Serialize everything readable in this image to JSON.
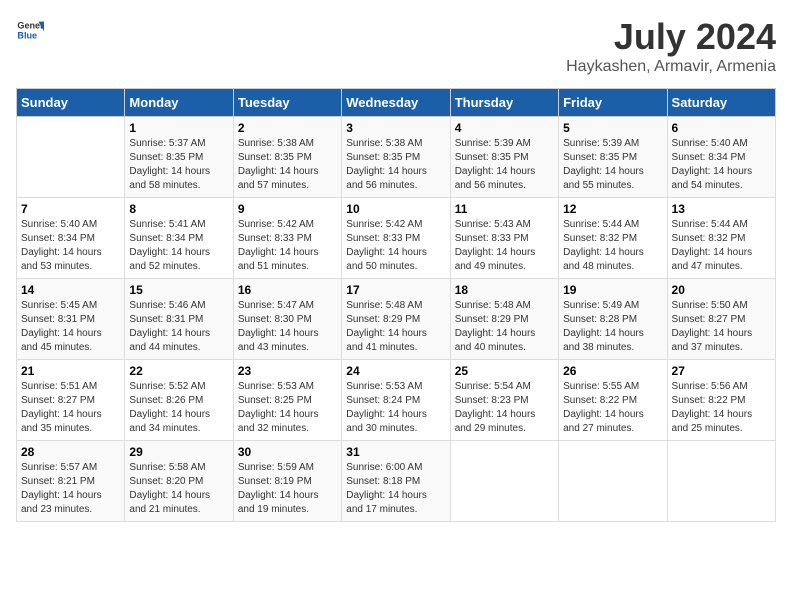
{
  "header": {
    "logo_general": "General",
    "logo_blue": "Blue",
    "month_title": "July 2024",
    "location": "Haykashen, Armavir, Armenia"
  },
  "calendar": {
    "weekdays": [
      "Sunday",
      "Monday",
      "Tuesday",
      "Wednesday",
      "Thursday",
      "Friday",
      "Saturday"
    ],
    "weeks": [
      [
        {
          "day": "",
          "info": ""
        },
        {
          "day": "1",
          "info": "Sunrise: 5:37 AM\nSunset: 8:35 PM\nDaylight: 14 hours\nand 58 minutes."
        },
        {
          "day": "2",
          "info": "Sunrise: 5:38 AM\nSunset: 8:35 PM\nDaylight: 14 hours\nand 57 minutes."
        },
        {
          "day": "3",
          "info": "Sunrise: 5:38 AM\nSunset: 8:35 PM\nDaylight: 14 hours\nand 56 minutes."
        },
        {
          "day": "4",
          "info": "Sunrise: 5:39 AM\nSunset: 8:35 PM\nDaylight: 14 hours\nand 56 minutes."
        },
        {
          "day": "5",
          "info": "Sunrise: 5:39 AM\nSunset: 8:35 PM\nDaylight: 14 hours\nand 55 minutes."
        },
        {
          "day": "6",
          "info": "Sunrise: 5:40 AM\nSunset: 8:34 PM\nDaylight: 14 hours\nand 54 minutes."
        }
      ],
      [
        {
          "day": "7",
          "info": "Sunrise: 5:40 AM\nSunset: 8:34 PM\nDaylight: 14 hours\nand 53 minutes."
        },
        {
          "day": "8",
          "info": "Sunrise: 5:41 AM\nSunset: 8:34 PM\nDaylight: 14 hours\nand 52 minutes."
        },
        {
          "day": "9",
          "info": "Sunrise: 5:42 AM\nSunset: 8:33 PM\nDaylight: 14 hours\nand 51 minutes."
        },
        {
          "day": "10",
          "info": "Sunrise: 5:42 AM\nSunset: 8:33 PM\nDaylight: 14 hours\nand 50 minutes."
        },
        {
          "day": "11",
          "info": "Sunrise: 5:43 AM\nSunset: 8:33 PM\nDaylight: 14 hours\nand 49 minutes."
        },
        {
          "day": "12",
          "info": "Sunrise: 5:44 AM\nSunset: 8:32 PM\nDaylight: 14 hours\nand 48 minutes."
        },
        {
          "day": "13",
          "info": "Sunrise: 5:44 AM\nSunset: 8:32 PM\nDaylight: 14 hours\nand 47 minutes."
        }
      ],
      [
        {
          "day": "14",
          "info": "Sunrise: 5:45 AM\nSunset: 8:31 PM\nDaylight: 14 hours\nand 45 minutes."
        },
        {
          "day": "15",
          "info": "Sunrise: 5:46 AM\nSunset: 8:31 PM\nDaylight: 14 hours\nand 44 minutes."
        },
        {
          "day": "16",
          "info": "Sunrise: 5:47 AM\nSunset: 8:30 PM\nDaylight: 14 hours\nand 43 minutes."
        },
        {
          "day": "17",
          "info": "Sunrise: 5:48 AM\nSunset: 8:29 PM\nDaylight: 14 hours\nand 41 minutes."
        },
        {
          "day": "18",
          "info": "Sunrise: 5:48 AM\nSunset: 8:29 PM\nDaylight: 14 hours\nand 40 minutes."
        },
        {
          "day": "19",
          "info": "Sunrise: 5:49 AM\nSunset: 8:28 PM\nDaylight: 14 hours\nand 38 minutes."
        },
        {
          "day": "20",
          "info": "Sunrise: 5:50 AM\nSunset: 8:27 PM\nDaylight: 14 hours\nand 37 minutes."
        }
      ],
      [
        {
          "day": "21",
          "info": "Sunrise: 5:51 AM\nSunset: 8:27 PM\nDaylight: 14 hours\nand 35 minutes."
        },
        {
          "day": "22",
          "info": "Sunrise: 5:52 AM\nSunset: 8:26 PM\nDaylight: 14 hours\nand 34 minutes."
        },
        {
          "day": "23",
          "info": "Sunrise: 5:53 AM\nSunset: 8:25 PM\nDaylight: 14 hours\nand 32 minutes."
        },
        {
          "day": "24",
          "info": "Sunrise: 5:53 AM\nSunset: 8:24 PM\nDaylight: 14 hours\nand 30 minutes."
        },
        {
          "day": "25",
          "info": "Sunrise: 5:54 AM\nSunset: 8:23 PM\nDaylight: 14 hours\nand 29 minutes."
        },
        {
          "day": "26",
          "info": "Sunrise: 5:55 AM\nSunset: 8:22 PM\nDaylight: 14 hours\nand 27 minutes."
        },
        {
          "day": "27",
          "info": "Sunrise: 5:56 AM\nSunset: 8:22 PM\nDaylight: 14 hours\nand 25 minutes."
        }
      ],
      [
        {
          "day": "28",
          "info": "Sunrise: 5:57 AM\nSunset: 8:21 PM\nDaylight: 14 hours\nand 23 minutes."
        },
        {
          "day": "29",
          "info": "Sunrise: 5:58 AM\nSunset: 8:20 PM\nDaylight: 14 hours\nand 21 minutes."
        },
        {
          "day": "30",
          "info": "Sunrise: 5:59 AM\nSunset: 8:19 PM\nDaylight: 14 hours\nand 19 minutes."
        },
        {
          "day": "31",
          "info": "Sunrise: 6:00 AM\nSunset: 8:18 PM\nDaylight: 14 hours\nand 17 minutes."
        },
        {
          "day": "",
          "info": ""
        },
        {
          "day": "",
          "info": ""
        },
        {
          "day": "",
          "info": ""
        }
      ]
    ]
  }
}
